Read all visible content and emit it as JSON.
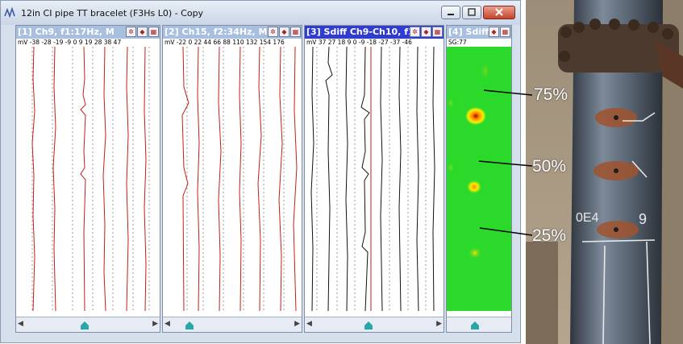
{
  "window": {
    "title": "12in CI pipe TT bracelet (F3Hs L0) - Copy"
  },
  "panels": [
    {
      "label": "[1] Ch9, f1:17Hz, M",
      "scale": "mV -38 -28 -19 -9  0   9   19  28  38  47",
      "active": false
    },
    {
      "label": "[2] Ch15, f2:34Hz, M",
      "scale": "mV -22  0   22  44  66  88  110 132 154 176",
      "active": false
    },
    {
      "label": "[3] Sdiff Ch9-Ch10, f1:...",
      "scale": "mV 37  27  18  9   0  -9  -18 -27 -37 -46",
      "active": true
    },
    {
      "label": "[4] Sdiff...",
      "scale": "SG:77",
      "active": false
    }
  ],
  "callouts": [
    "75%",
    "50%",
    "25%"
  ],
  "photo_text": [
    "0E4",
    "9"
  ],
  "icons": {
    "app": "signal-app-icon",
    "panel_tools": [
      "zoom-icon",
      "color-icon",
      "settings-icon"
    ]
  },
  "colors": {
    "active_header": "#2f3ccf",
    "inactive_header": "#a9bfdf",
    "heatmap_bg": "#2bd92b",
    "trace_red": "#c0201a"
  }
}
